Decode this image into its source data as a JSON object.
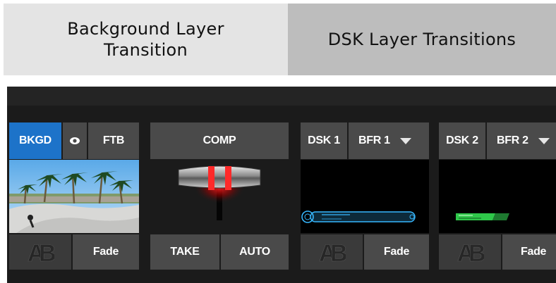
{
  "headers": {
    "left": "Background Layer Transition",
    "right": "DSK Layer Transitions"
  },
  "bkgd": {
    "bkgd_label": "BKGD",
    "eye_icon": "eye-icon",
    "ftb_label": "FTB",
    "transition_label": "Fade"
  },
  "center": {
    "comp_label": "COMP",
    "take_label": "TAKE",
    "auto_label": "AUTO"
  },
  "dsk1": {
    "label": "DSK 1",
    "buffer": "BFR 1",
    "transition_label": "Fade"
  },
  "dsk2": {
    "label": "DSK 2",
    "buffer": "BFR 2",
    "transition_label": "Fade"
  },
  "colors": {
    "accent_blue": "#1d73c9",
    "tbar_red": "#ff2a2a",
    "dsk1_cyan": "#37b8ff",
    "dsk2_green": "#2fc84a"
  }
}
